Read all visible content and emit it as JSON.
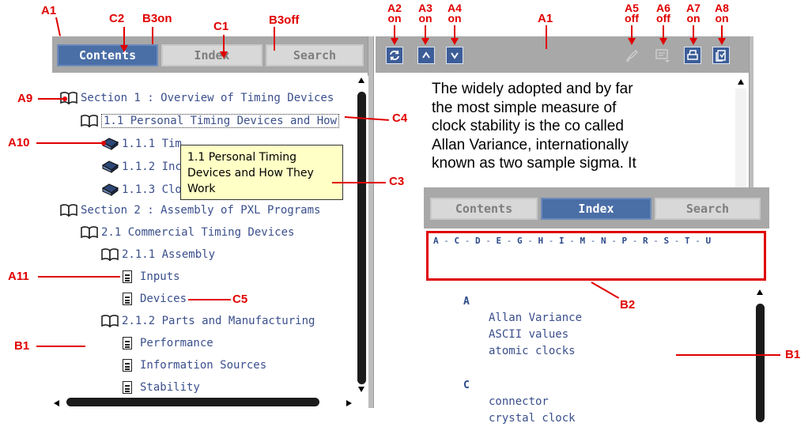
{
  "annotations": {
    "a1_left": "A1",
    "c2": "C2",
    "b3on": "B3on",
    "c1": "C1",
    "b3off": "B3off",
    "a2": {
      "code": "A2",
      "state": "on"
    },
    "a3": {
      "code": "A3",
      "state": "on"
    },
    "a4": {
      "code": "A4",
      "state": "on"
    },
    "a1_right": "A1",
    "a5": {
      "code": "A5",
      "state": "off"
    },
    "a6": {
      "code": "A6",
      "state": "off"
    },
    "a7": {
      "code": "A7",
      "state": "on"
    },
    "a8": {
      "code": "A8",
      "state": "on"
    },
    "a9": "A9",
    "c4": "C4",
    "a10": "A10",
    "c3": "C3",
    "a11": "A11",
    "c5": "C5",
    "b1_left": "B1",
    "b2": "B2",
    "b1_right": "B1"
  },
  "left_panel": {
    "tabs": {
      "contents": "Contents",
      "index": "Index",
      "search": "Search"
    },
    "tree": [
      "Section 1 : Overview of Timing Devices",
      "1.1 Personal Timing Devices and How",
      "1.1.1 Tim",
      "1.1.2 Inc",
      "1.1.3 Clo",
      "Section 2 : Assembly of PXL Programs",
      "2.1 Commercial Timing Devices",
      "2.1.1 Assembly",
      "Inputs",
      "Devices",
      "2.1.2 Parts and Manufacturing",
      "Performance",
      "Information Sources",
      "Stability"
    ],
    "tooltip": "1.1 Personal Timing Devices and How They Work"
  },
  "content": {
    "lines": [
      "The widely adopted and by far",
      "the most simple measure of",
      "clock stability is the co called",
      "Allan Variance, internationally",
      "known as two sample sigma. It"
    ]
  },
  "index_panel": {
    "tabs": {
      "contents": "Contents",
      "index": "Index",
      "search": "Search"
    },
    "alphabet": [
      "A",
      "C",
      "D",
      "E",
      "G",
      "H",
      "I",
      "M",
      "N",
      "P",
      "R",
      "S",
      "T",
      "U"
    ],
    "groups": [
      {
        "letter": "A",
        "terms": [
          "Allan Variance",
          "ASCII values",
          "atomic clocks"
        ]
      },
      {
        "letter": "C",
        "terms": [
          "connector",
          "crystal clock"
        ]
      }
    ]
  },
  "colors": {
    "annotation": "#e00000",
    "active_tab": "#4a6ea6",
    "link": "#3a4f8c"
  },
  "icons": [
    "sync-icon",
    "up-icon",
    "down-icon",
    "highlight-icon",
    "comment-icon",
    "print-icon",
    "bookmark-icon",
    "book-open-icon",
    "book-closed-icon",
    "document-icon"
  ]
}
